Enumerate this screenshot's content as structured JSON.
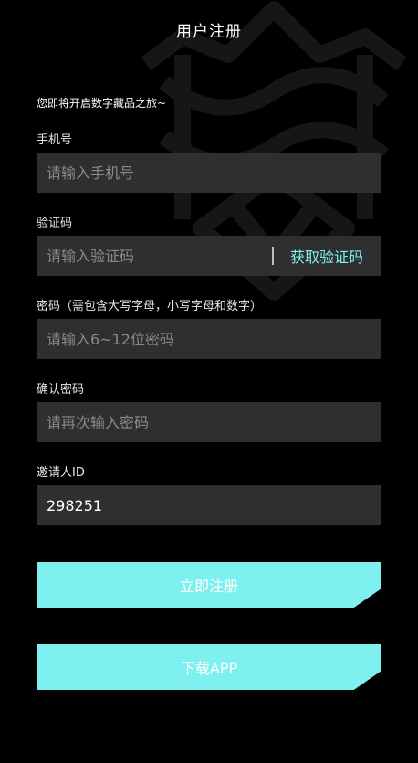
{
  "header": {
    "title": "用户注册"
  },
  "intro": "您即将开启数字藏品之旅~",
  "form": {
    "phone": {
      "label": "手机号",
      "placeholder": "请输入手机号",
      "value": ""
    },
    "code": {
      "label": "验证码",
      "placeholder": "请输入验证码",
      "value": "",
      "action_label": "获取验证码"
    },
    "password": {
      "label": "密码（需包含大写字母，小写字母和数字）",
      "placeholder": "请输入6~12位密码",
      "value": ""
    },
    "confirm": {
      "label": "确认密码",
      "placeholder": "请再次输入密码",
      "value": ""
    },
    "inviter": {
      "label": "邀请人ID",
      "placeholder": "",
      "value": "298251"
    }
  },
  "buttons": {
    "register_label": "立即注册",
    "download_label": "下载APP"
  },
  "colors": {
    "accent": "#7ef0ef",
    "field_bg": "#2f2f2f",
    "page_bg": "#000000"
  }
}
